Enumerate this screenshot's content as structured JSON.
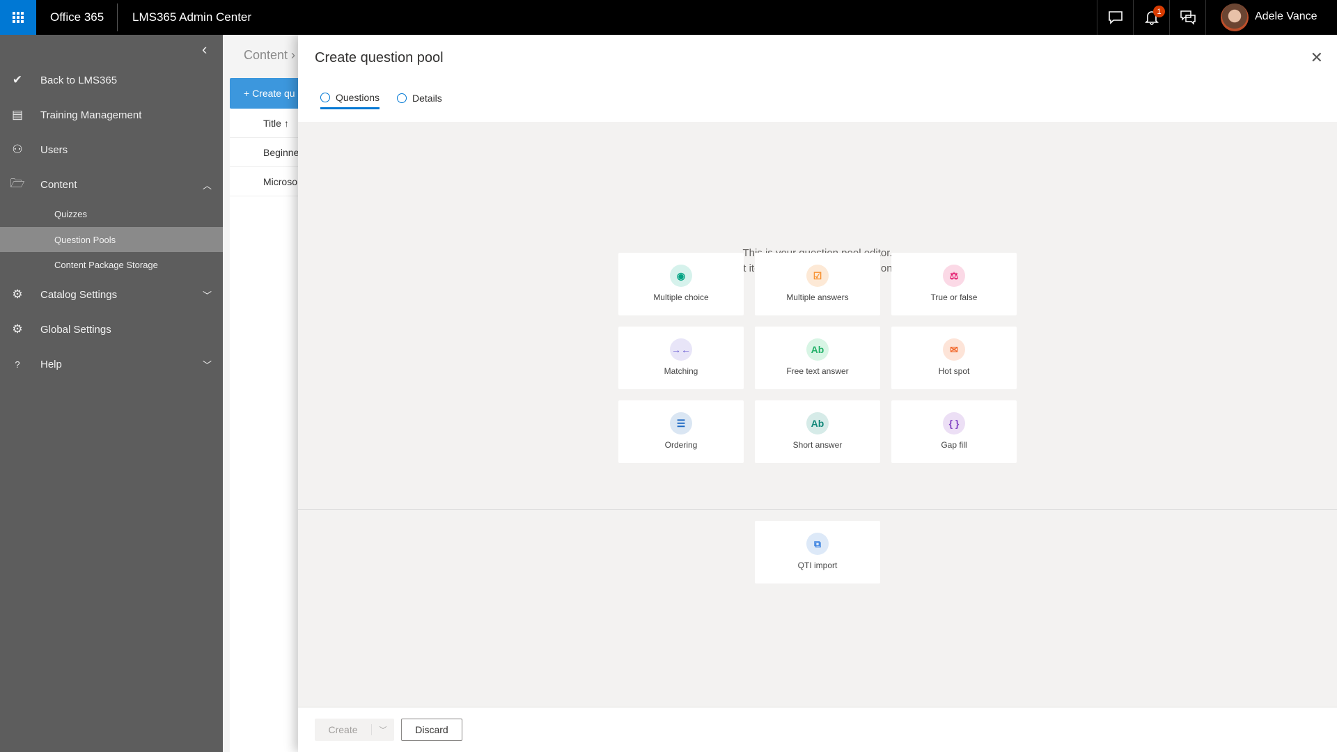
{
  "topbar": {
    "brand": "Office 365",
    "app_title": "LMS365 Admin Center",
    "notification_count": "1",
    "user_name": "Adele Vance",
    "accent": "#0078d4"
  },
  "sidebar": {
    "items": [
      {
        "label": "Back to LMS365",
        "icon": "lms-check-icon"
      },
      {
        "label": "Training Management",
        "icon": "document-icon"
      },
      {
        "label": "Users",
        "icon": "users-icon"
      },
      {
        "label": "Content",
        "icon": "folder-icon",
        "expanded": true
      },
      {
        "label": "Catalog Settings",
        "icon": "gear-icon"
      },
      {
        "label": "Global Settings",
        "icon": "admin-settings-icon"
      },
      {
        "label": "Help",
        "icon": "question-icon",
        "help_glyph": "?"
      }
    ],
    "subitems": [
      {
        "label": "Quizzes"
      },
      {
        "label": "Question Pools",
        "active": true
      },
      {
        "label": "Content Package Storage"
      }
    ]
  },
  "page": {
    "breadcrumb": "Content ›",
    "create_button": "+ Create qu",
    "column_title": "Title ↑",
    "rows": [
      "Beginne",
      "Microso"
    ]
  },
  "panel": {
    "title": "Create question pool",
    "tabs": [
      {
        "label": "Questions",
        "active": true
      },
      {
        "label": "Details"
      }
    ],
    "intro_line1": "This is your question pool editor.",
    "intro_line2": "Select items to include in the question pool.",
    "cards": [
      {
        "label": "Multiple choice",
        "glyph": "◉",
        "color": "#00a383",
        "bg": "#d6f2ec"
      },
      {
        "label": "Multiple answers",
        "glyph": "☑",
        "color": "#f7902f",
        "bg": "#fde9d6"
      },
      {
        "label": "True or false",
        "glyph": "⚖",
        "color": "#e3196d",
        "bg": "#fbd9e6"
      },
      {
        "label": "Matching",
        "glyph": "→←",
        "color": "#6b5fd3",
        "bg": "#e8e5f8"
      },
      {
        "label": "Free text answer",
        "glyph": "Ab",
        "color": "#26b36b",
        "bg": "#d8f5e5"
      },
      {
        "label": "Hot spot",
        "glyph": "✉",
        "color": "#f26b2f",
        "bg": "#fde4d8"
      },
      {
        "label": "Ordering",
        "glyph": "☰",
        "color": "#1a66c2",
        "bg": "#dae6f3"
      },
      {
        "label": "Short answer",
        "glyph": "Ab",
        "color": "#12887a",
        "bg": "#d6ebe8"
      },
      {
        "label": "Gap fill",
        "glyph": "{ }",
        "color": "#8346c4",
        "bg": "#ecdff5"
      }
    ],
    "import_card": {
      "label": "QTI import",
      "glyph": "⧉",
      "color": "#3b82e0",
      "bg": "#dde9f8"
    },
    "create_label": "Create",
    "discard_label": "Discard"
  }
}
